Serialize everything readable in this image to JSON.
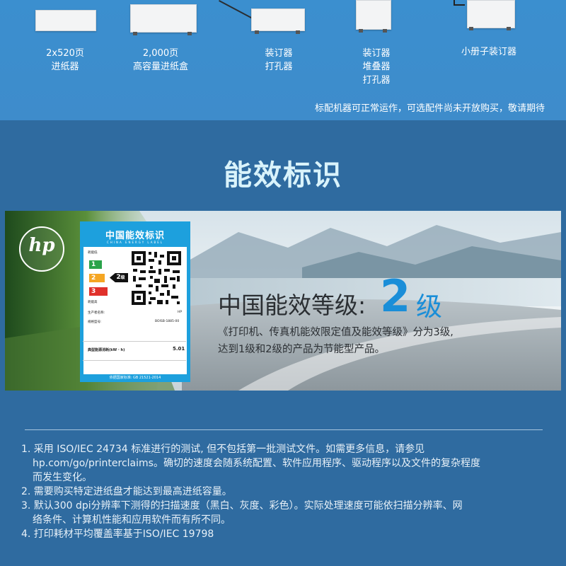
{
  "accessories": [
    {
      "lines": [
        "2x520页",
        "进纸器"
      ]
    },
    {
      "lines": [
        "2,000页",
        "高容量进纸盒"
      ]
    },
    {
      "lines": [
        "装订器",
        "打孔器"
      ]
    },
    {
      "lines": [
        "装订器",
        "堆叠器",
        "打孔器"
      ]
    },
    {
      "lines": [
        "小册子装订器"
      ]
    }
  ],
  "accessory_note": "标配机器可正常运作，可选配件尚未开放购买，敬请期待",
  "section_title": "能效标识",
  "brand_logo": "hp",
  "energy_label": {
    "title": "中国能效标识",
    "subtitle": "CHINA ENERGY LABEL",
    "low_consumption": "耗能低",
    "high_consumption": "耗能高",
    "grades": [
      "1",
      "2",
      "3"
    ],
    "rated_grade": "2",
    "rated_grade_suffix": "级",
    "manufacturer_label": "生产者名称:",
    "manufacturer_value": "HP",
    "model_label": "规格型号:",
    "model_value": "BOISB-1885-00",
    "energy_label_text": "典型能源消耗(kW · h)",
    "energy_value": "5.01",
    "footer": "依据国家标准: GB 21521-2014"
  },
  "grade_title": "中国能效等级:",
  "grade_number": "2",
  "grade_unit": "级",
  "grade_description": [
    "《打印机、传真机能效限定值及能效等级》分为3级,",
    "达到1级和2级的产品为节能型产品。"
  ],
  "footnotes": [
    {
      "lines": [
        "1. 采用 ISO/IEC 24734 标准进行的测试, 但不包括第一批测试文件。如需更多信息，请参见",
        "hp.com/go/printerclaims。确切的速度会随系统配置、软件应用程序、驱动程序以及文件的复杂程度",
        "而发生变化。"
      ]
    },
    {
      "lines": [
        "2. 需要购买特定进纸盘才能达到最高进纸容量。"
      ]
    },
    {
      "lines": [
        "3. 默认300 dpi分辨率下测得的扫描速度（黑白、灰度、彩色）。实际处理速度可能依扫描分辨率、网",
        "络条件、计算机性能和应用软件而有所不同。"
      ]
    },
    {
      "lines": [
        "4. 打印耗材平均覆盖率基于ISO/IEC 19798"
      ]
    }
  ],
  "colors": {
    "accessory_bg": "#3e8ccb",
    "section_bg": "#2f6ba0",
    "title_text": "#d9f3fb",
    "label_blue": "#1da0dd",
    "grade_blue": "#1a8ed8",
    "grade1": "#2aa34a",
    "grade2": "#f5a623",
    "grade3": "#e0312b"
  }
}
